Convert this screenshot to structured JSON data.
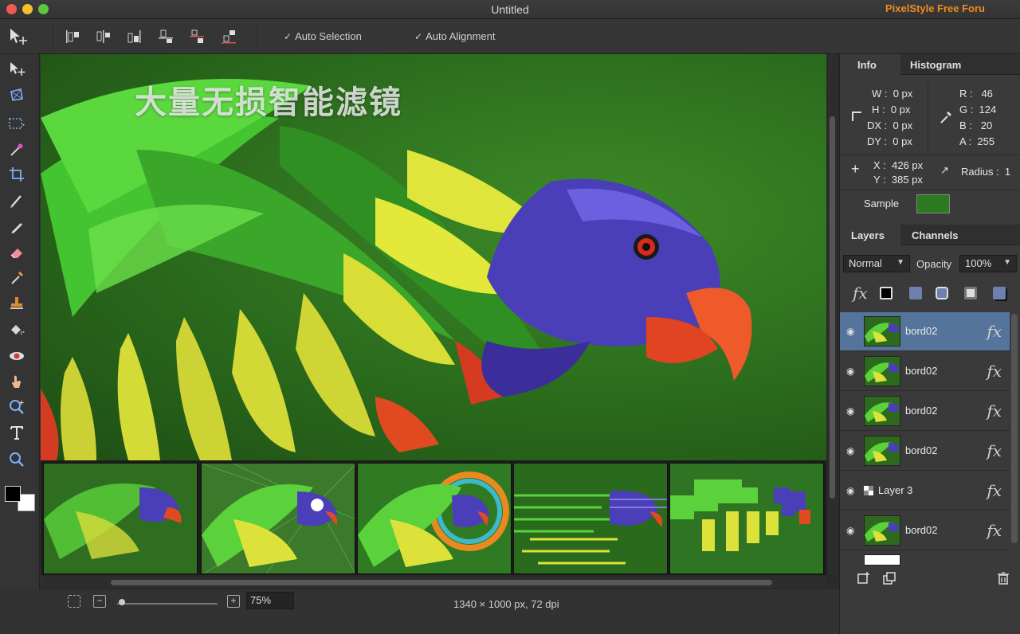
{
  "window": {
    "title": "Untitled",
    "brand": "PixelStyle Free Foru"
  },
  "toolbar": {
    "auto_selection": "Auto Selection",
    "auto_alignment": "Auto Alignment"
  },
  "canvas": {
    "overlay_text": "大量无损智能滤镜"
  },
  "statusbar": {
    "zoom": "75%",
    "doc_info": "1340 × 1000 px, 72 dpi"
  },
  "info_panel": {
    "tabs": [
      "Info",
      "Histogram"
    ],
    "w": "W :  0 px",
    "h": "H :  0 px",
    "dx": "DX :  0 px",
    "dy": "DY :  0 px",
    "r": "R :   46",
    "g": "G :  124",
    "b": "B :   20",
    "a": "A :  255",
    "x": "X :  426 px",
    "y": "Y :  385 px",
    "radius": "Radius :  1",
    "sample_label": "Sample",
    "sample_color": "#2b7a20"
  },
  "layers_panel": {
    "tabs": [
      "Layers",
      "Channels"
    ],
    "blend_mode": "Normal",
    "opacity_label": "Opacity",
    "opacity": "100%",
    "fx": "fx",
    "layers": [
      {
        "name": "bord02",
        "selected": true
      },
      {
        "name": "bord02",
        "selected": false
      },
      {
        "name": "bord02",
        "selected": false
      },
      {
        "name": "bord02",
        "selected": false
      },
      {
        "name": "Layer 3",
        "selected": false
      },
      {
        "name": "bord02",
        "selected": false
      }
    ]
  },
  "colors": {
    "accent_selected": "#55749b",
    "brand": "#f08a20"
  }
}
